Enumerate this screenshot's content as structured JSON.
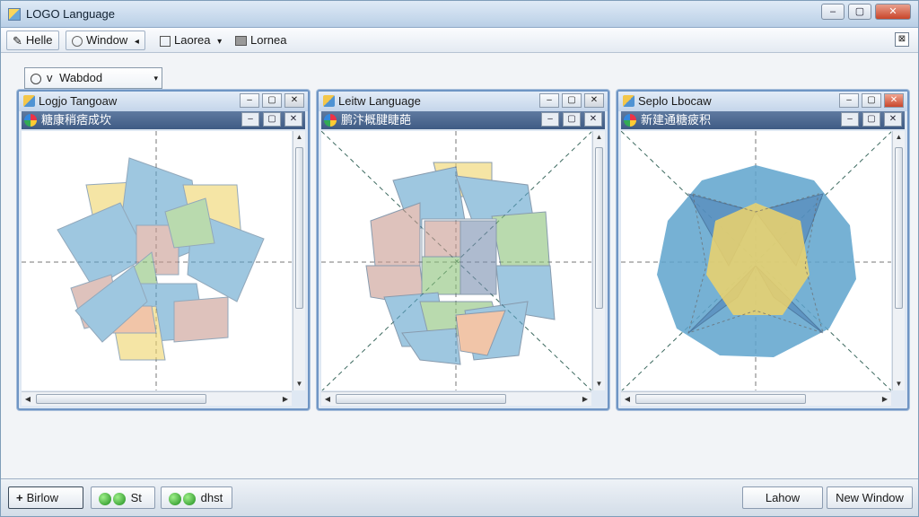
{
  "app": {
    "title": "LOGO Language"
  },
  "window_controls": {
    "minimize": "–",
    "maximize": "▢",
    "close": "✕"
  },
  "toolbar": {
    "items": [
      {
        "label": "Helle",
        "icon": "pencil-icon"
      },
      {
        "label": "Window",
        "icon": "circle-icon",
        "arrow": "◂"
      },
      {
        "label": "Laorea",
        "icon": "square-icon",
        "arrow": "▾"
      },
      {
        "label": "Lornea",
        "icon": "grid-icon"
      }
    ],
    "right_icon": "⊠"
  },
  "dropdown": {
    "value": "Wabdod",
    "prefix": "v",
    "arrow": "▾"
  },
  "child_windows": [
    {
      "title": "Logjo Tangoaw",
      "subtitle": "糖康稍痞成坎"
    },
    {
      "title": "Leitw Language",
      "subtitle": "鹏汴概腱睫葩"
    },
    {
      "title": "Seplo Lbocaw",
      "subtitle": "新建通糖疲积"
    }
  ],
  "child_buttons": {
    "min": "–",
    "max": "▢",
    "close": "✕"
  },
  "statusbar": {
    "left": [
      {
        "label": "Birlow",
        "icon": "plus-icon"
      },
      {
        "label": "St",
        "icon": "green-dot-icon"
      },
      {
        "label": "dhst",
        "icon": "green-dot-icon"
      }
    ],
    "right": [
      {
        "label": "Lahow"
      },
      {
        "label": "New Window"
      }
    ]
  },
  "colors": {
    "blue": "#5ea3cc",
    "yellow": "#efd46a",
    "green": "#8cc37a",
    "rose": "#c99a90"
  }
}
